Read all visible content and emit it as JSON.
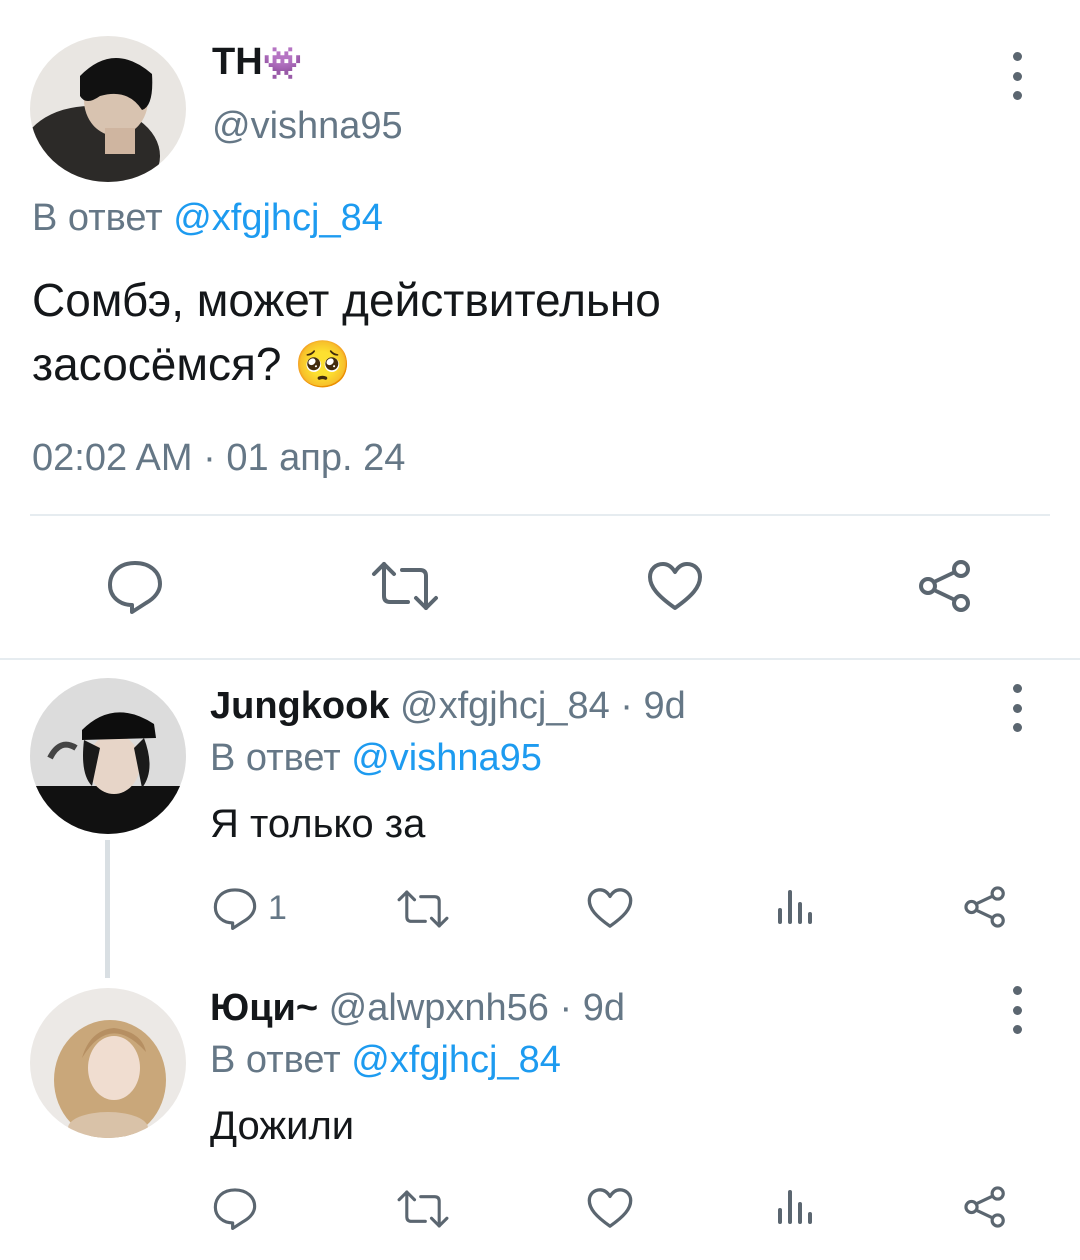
{
  "main_tweet": {
    "display_name": "ТН",
    "display_emoji": "👾",
    "handle": "@vishna95",
    "reply_prefix": "В ответ",
    "reply_to": "@xfgjhcj_84",
    "text_line1": "Сомбэ, может действительно",
    "text_line2": "засосёмся?",
    "text_emoji": "🥺",
    "timestamp": "02:02 AM · 01 апр. 24"
  },
  "replies": [
    {
      "display_name": "Jungkook",
      "handle": "@xfgjhcj_84",
      "age": "· 9d",
      "reply_prefix": "В ответ",
      "reply_to": "@vishna95",
      "text": "Я только за",
      "reply_count": "1"
    },
    {
      "display_name": "Юци~",
      "handle": "@alwpxnh56",
      "age": "· 9d",
      "reply_prefix": "В ответ",
      "reply_to": "@xfgjhcj_84",
      "text": "Дожили",
      "reply_count": ""
    }
  ],
  "colors": {
    "link": "#1d9bf0",
    "muted": "#657786",
    "icon": "#5b6670",
    "divider": "#e6ecf0"
  },
  "icons": [
    "reply-icon",
    "retweet-icon",
    "like-icon",
    "share-icon",
    "views-icon",
    "more-icon"
  ]
}
